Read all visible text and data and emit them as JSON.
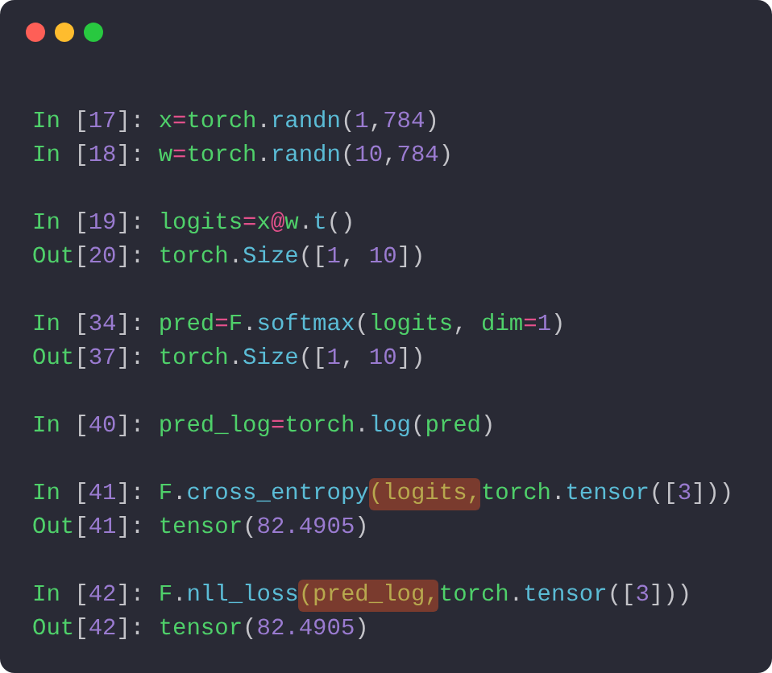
{
  "window": {
    "controls": [
      {
        "kind": "close"
      },
      {
        "kind": "minimize"
      },
      {
        "kind": "zoom"
      }
    ]
  },
  "cells": [
    {
      "lines": [
        {
          "tokens": [
            {
              "text": "In ",
              "kind": "prompt"
            },
            {
              "text": "[",
              "kind": "punct"
            },
            {
              "text": "17",
              "kind": "num"
            },
            {
              "text": "]: ",
              "kind": "punct"
            },
            {
              "text": "x",
              "kind": "name"
            },
            {
              "text": "=",
              "kind": "op"
            },
            {
              "text": "torch",
              "kind": "name"
            },
            {
              "text": ".",
              "kind": "punct"
            },
            {
              "text": "randn",
              "kind": "func"
            },
            {
              "text": "(",
              "kind": "punct"
            },
            {
              "text": "1",
              "kind": "num"
            },
            {
              "text": ",",
              "kind": "punct"
            },
            {
              "text": "784",
              "kind": "num"
            },
            {
              "text": ")",
              "kind": "punct"
            }
          ]
        },
        {
          "tokens": [
            {
              "text": "In ",
              "kind": "prompt"
            },
            {
              "text": "[",
              "kind": "punct"
            },
            {
              "text": "18",
              "kind": "num"
            },
            {
              "text": "]: ",
              "kind": "punct"
            },
            {
              "text": "w",
              "kind": "name"
            },
            {
              "text": "=",
              "kind": "op"
            },
            {
              "text": "torch",
              "kind": "name"
            },
            {
              "text": ".",
              "kind": "punct"
            },
            {
              "text": "randn",
              "kind": "func"
            },
            {
              "text": "(",
              "kind": "punct"
            },
            {
              "text": "10",
              "kind": "num"
            },
            {
              "text": ",",
              "kind": "punct"
            },
            {
              "text": "784",
              "kind": "num"
            },
            {
              "text": ")",
              "kind": "punct"
            }
          ]
        }
      ]
    },
    {
      "lines": [
        {
          "tokens": [
            {
              "text": "In ",
              "kind": "prompt"
            },
            {
              "text": "[",
              "kind": "punct"
            },
            {
              "text": "19",
              "kind": "num"
            },
            {
              "text": "]: ",
              "kind": "punct"
            },
            {
              "text": "logits",
              "kind": "name"
            },
            {
              "text": "=",
              "kind": "op"
            },
            {
              "text": "x",
              "kind": "name"
            },
            {
              "text": "@",
              "kind": "op"
            },
            {
              "text": "w",
              "kind": "name"
            },
            {
              "text": ".",
              "kind": "punct"
            },
            {
              "text": "t",
              "kind": "func"
            },
            {
              "text": "()",
              "kind": "punct"
            }
          ]
        },
        {
          "tokens": [
            {
              "text": "Out",
              "kind": "prompt"
            },
            {
              "text": "[",
              "kind": "punct"
            },
            {
              "text": "20",
              "kind": "num"
            },
            {
              "text": "]: ",
              "kind": "punct"
            },
            {
              "text": "torch",
              "kind": "name"
            },
            {
              "text": ".",
              "kind": "punct"
            },
            {
              "text": "Size",
              "kind": "func"
            },
            {
              "text": "([",
              "kind": "punct"
            },
            {
              "text": "1",
              "kind": "num"
            },
            {
              "text": ", ",
              "kind": "punct"
            },
            {
              "text": "10",
              "kind": "num"
            },
            {
              "text": "])",
              "kind": "punct"
            }
          ]
        }
      ]
    },
    {
      "lines": [
        {
          "tokens": [
            {
              "text": "In ",
              "kind": "prompt"
            },
            {
              "text": "[",
              "kind": "punct"
            },
            {
              "text": "34",
              "kind": "num"
            },
            {
              "text": "]: ",
              "kind": "punct"
            },
            {
              "text": "pred",
              "kind": "name"
            },
            {
              "text": "=",
              "kind": "op"
            },
            {
              "text": "F",
              "kind": "name"
            },
            {
              "text": ".",
              "kind": "punct"
            },
            {
              "text": "softmax",
              "kind": "func"
            },
            {
              "text": "(",
              "kind": "punct"
            },
            {
              "text": "logits",
              "kind": "name"
            },
            {
              "text": ", ",
              "kind": "punct"
            },
            {
              "text": "dim",
              "kind": "name"
            },
            {
              "text": "=",
              "kind": "op"
            },
            {
              "text": "1",
              "kind": "num"
            },
            {
              "text": ")",
              "kind": "punct"
            }
          ]
        },
        {
          "tokens": [
            {
              "text": "Out",
              "kind": "prompt"
            },
            {
              "text": "[",
              "kind": "punct"
            },
            {
              "text": "37",
              "kind": "num"
            },
            {
              "text": "]: ",
              "kind": "punct"
            },
            {
              "text": "torch",
              "kind": "name"
            },
            {
              "text": ".",
              "kind": "punct"
            },
            {
              "text": "Size",
              "kind": "func"
            },
            {
              "text": "([",
              "kind": "punct"
            },
            {
              "text": "1",
              "kind": "num"
            },
            {
              "text": ", ",
              "kind": "punct"
            },
            {
              "text": "10",
              "kind": "num"
            },
            {
              "text": "])",
              "kind": "punct"
            }
          ]
        }
      ]
    },
    {
      "lines": [
        {
          "tokens": [
            {
              "text": "In ",
              "kind": "prompt"
            },
            {
              "text": "[",
              "kind": "punct"
            },
            {
              "text": "40",
              "kind": "num"
            },
            {
              "text": "]: ",
              "kind": "punct"
            },
            {
              "text": "pred_log",
              "kind": "name"
            },
            {
              "text": "=",
              "kind": "op"
            },
            {
              "text": "torch",
              "kind": "name"
            },
            {
              "text": ".",
              "kind": "punct"
            },
            {
              "text": "log",
              "kind": "func"
            },
            {
              "text": "(",
              "kind": "punct"
            },
            {
              "text": "pred",
              "kind": "name"
            },
            {
              "text": ")",
              "kind": "punct"
            }
          ]
        }
      ]
    },
    {
      "lines": [
        {
          "tokens": [
            {
              "text": "In ",
              "kind": "prompt"
            },
            {
              "text": "[",
              "kind": "punct"
            },
            {
              "text": "41",
              "kind": "num"
            },
            {
              "text": "]: ",
              "kind": "punct"
            },
            {
              "text": "F",
              "kind": "name"
            },
            {
              "text": ".",
              "kind": "punct"
            },
            {
              "text": "cross_entropy",
              "kind": "func"
            },
            {
              "text": "(logits,",
              "kind": "name",
              "highlighted": true
            },
            {
              "text": "torch",
              "kind": "name"
            },
            {
              "text": ".",
              "kind": "punct"
            },
            {
              "text": "tensor",
              "kind": "func"
            },
            {
              "text": "([",
              "kind": "punct"
            },
            {
              "text": "3",
              "kind": "num"
            },
            {
              "text": "]))",
              "kind": "punct"
            }
          ]
        },
        {
          "tokens": [
            {
              "text": "Out",
              "kind": "prompt"
            },
            {
              "text": "[",
              "kind": "punct"
            },
            {
              "text": "41",
              "kind": "num"
            },
            {
              "text": "]: ",
              "kind": "punct"
            },
            {
              "text": "tensor",
              "kind": "name"
            },
            {
              "text": "(",
              "kind": "punct"
            },
            {
              "text": "82.4905",
              "kind": "num"
            },
            {
              "text": ")",
              "kind": "punct"
            }
          ]
        }
      ]
    },
    {
      "lines": [
        {
          "tokens": [
            {
              "text": "In ",
              "kind": "prompt"
            },
            {
              "text": "[",
              "kind": "punct"
            },
            {
              "text": "42",
              "kind": "num"
            },
            {
              "text": "]: ",
              "kind": "punct"
            },
            {
              "text": "F",
              "kind": "name"
            },
            {
              "text": ".",
              "kind": "punct"
            },
            {
              "text": "nll_loss",
              "kind": "func"
            },
            {
              "text": "(pred_log,",
              "kind": "name",
              "highlighted": true
            },
            {
              "text": "torch",
              "kind": "name"
            },
            {
              "text": ".",
              "kind": "punct"
            },
            {
              "text": "tensor",
              "kind": "func"
            },
            {
              "text": "([",
              "kind": "punct"
            },
            {
              "text": "3",
              "kind": "num"
            },
            {
              "text": "]))",
              "kind": "punct"
            }
          ]
        },
        {
          "tokens": [
            {
              "text": "Out",
              "kind": "prompt"
            },
            {
              "text": "[",
              "kind": "punct"
            },
            {
              "text": "42",
              "kind": "num"
            },
            {
              "text": "]: ",
              "kind": "punct"
            },
            {
              "text": "tensor",
              "kind": "name"
            },
            {
              "text": "(",
              "kind": "punct"
            },
            {
              "text": "82.4905",
              "kind": "num"
            },
            {
              "text": ")",
              "kind": "punct"
            }
          ]
        }
      ]
    }
  ]
}
